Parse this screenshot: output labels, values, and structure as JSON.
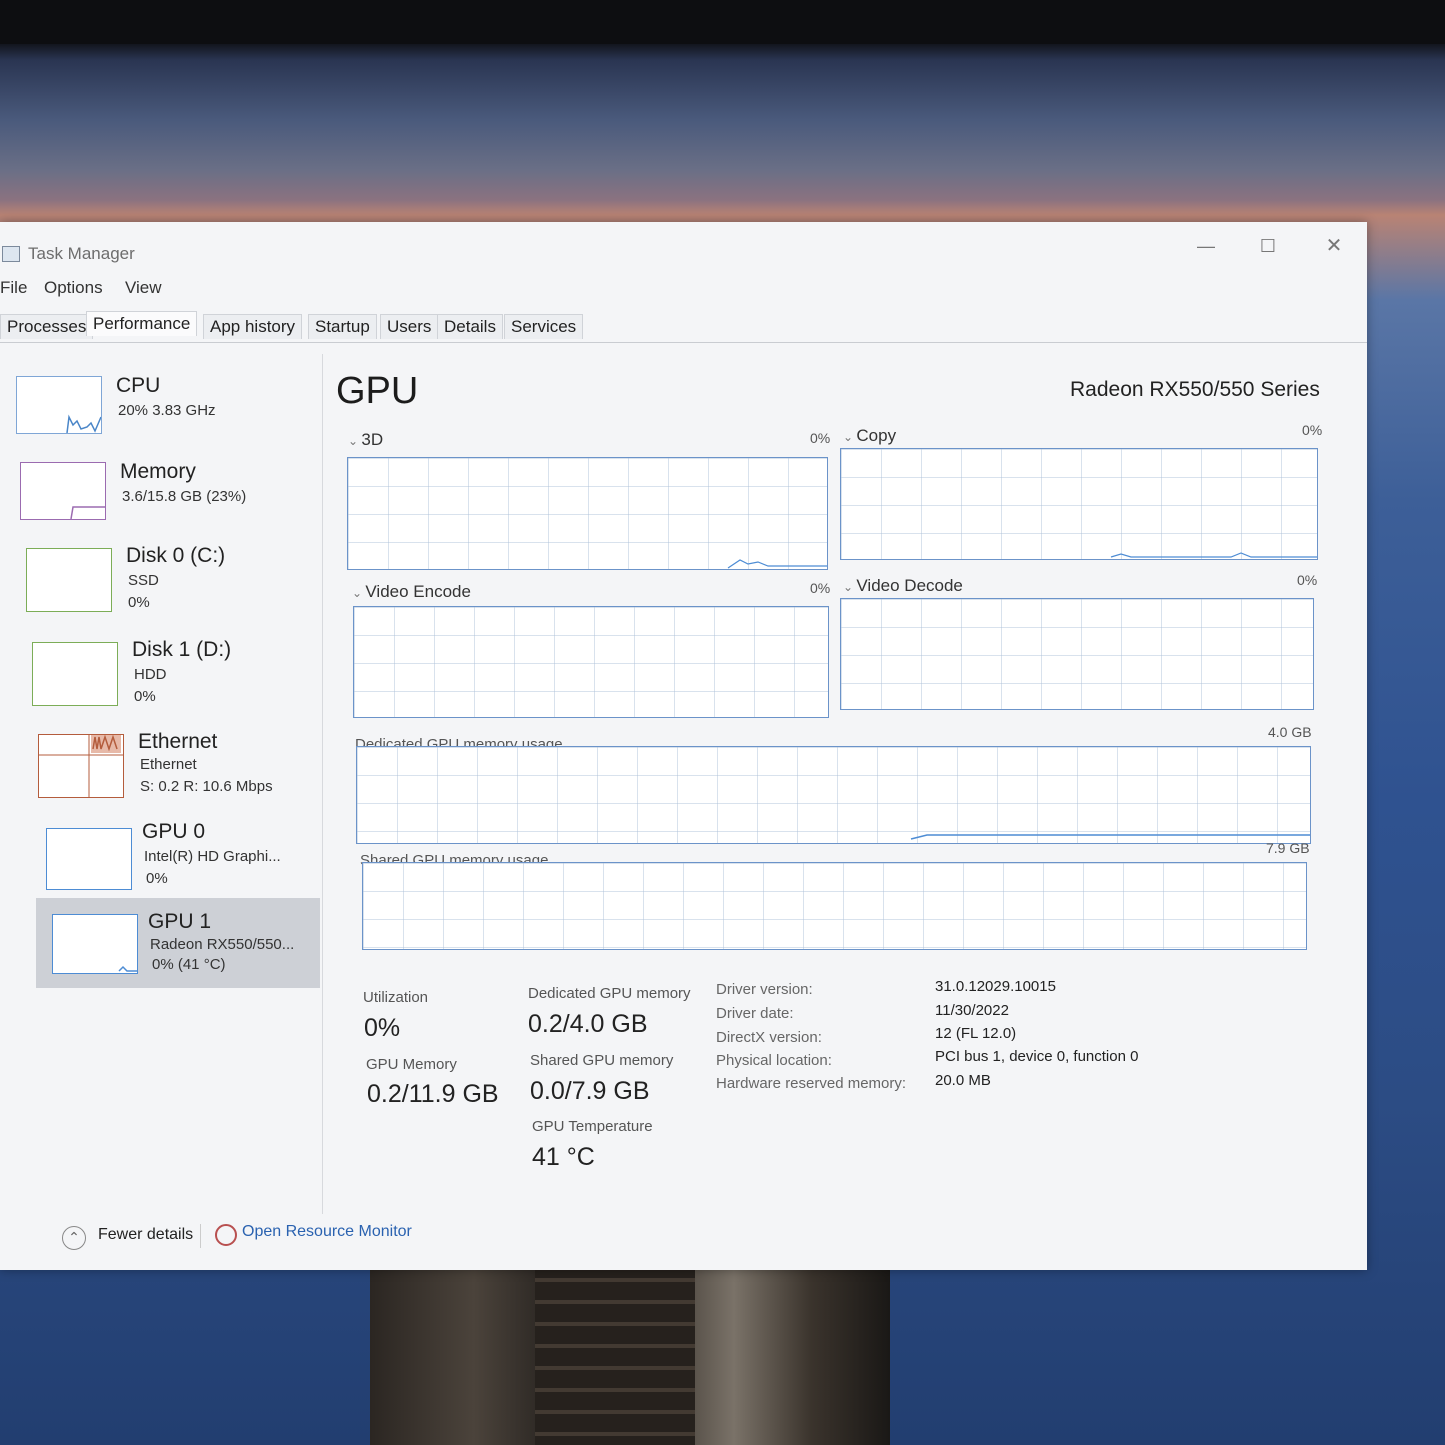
{
  "window": {
    "title": "Task Manager"
  },
  "menu": [
    "File",
    "Options",
    "View"
  ],
  "tabs": [
    "Processes",
    "Performance",
    "App history",
    "Startup",
    "Users",
    "Details",
    "Services"
  ],
  "sidebar": [
    {
      "name": "CPU",
      "line1": "20% 3.83 GHz",
      "line2": ""
    },
    {
      "name": "Memory",
      "line1": "3.6/15.8 GB (23%)",
      "line2": ""
    },
    {
      "name": "Disk 0 (C:)",
      "line1": "SSD",
      "line2": "0%"
    },
    {
      "name": "Disk 1 (D:)",
      "line1": "HDD",
      "line2": "0%"
    },
    {
      "name": "Ethernet",
      "line1": "Ethernet",
      "line2": "S: 0.2 R: 10.6 Mbps"
    },
    {
      "name": "GPU 0",
      "line1": "Intel(R) HD Graphi...",
      "line2": "0%"
    },
    {
      "name": "GPU 1",
      "line1": "Radeon RX550/550...",
      "line2": "0% (41 °C)"
    }
  ],
  "main": {
    "title": "GPU",
    "model": "Radeon RX550/550 Series",
    "graphs": {
      "g3d": {
        "label": "3D",
        "pct": "0%"
      },
      "copy": {
        "label": "Copy",
        "pct": "0%"
      },
      "encode": {
        "label": "Video Encode",
        "pct": "0%"
      },
      "decode": {
        "label": "Video Decode",
        "pct": "0%"
      },
      "dedicated": {
        "label": "Dedicated GPU memory usage",
        "max": "4.0 GB"
      },
      "shared": {
        "label": "Shared GPU memory usage",
        "max": "7.9 GB"
      }
    },
    "stats": {
      "utilization": {
        "label": "Utilization",
        "value": "0%"
      },
      "dedicated": {
        "label": "Dedicated GPU memory",
        "value": "0.2/4.0 GB"
      },
      "gpu_memory": {
        "label": "GPU Memory",
        "value": "0.2/11.9 GB"
      },
      "shared": {
        "label": "Shared GPU memory",
        "value": "0.0/7.9 GB"
      },
      "temperature": {
        "label": "GPU Temperature",
        "value": "41 °C"
      }
    },
    "info": [
      {
        "label": "Driver version:",
        "value": "31.0.12029.10015"
      },
      {
        "label": "Driver date:",
        "value": "11/30/2022"
      },
      {
        "label": "DirectX version:",
        "value": "12 (FL 12.0)"
      },
      {
        "label": "Physical location:",
        "value": "PCI bus 1, device 0, function 0"
      },
      {
        "label": "Hardware reserved memory:",
        "value": "20.0 MB"
      }
    ]
  },
  "footer": {
    "fewer": "Fewer details",
    "monitor": "Open Resource Monitor"
  }
}
